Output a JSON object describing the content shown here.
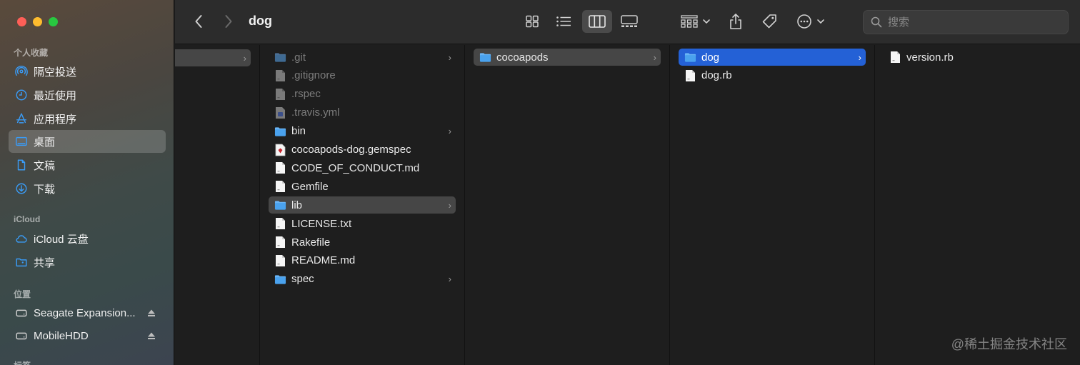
{
  "window": {
    "title": "dog"
  },
  "sidebar": {
    "sections": [
      {
        "label": "个人收藏"
      },
      {
        "label": "iCloud"
      },
      {
        "label": "位置"
      },
      {
        "label": "标签"
      }
    ],
    "favorites": [
      {
        "label": "隔空投送",
        "icon": "airdrop-icon"
      },
      {
        "label": "最近使用",
        "icon": "clock-icon"
      },
      {
        "label": "应用程序",
        "icon": "applications-icon"
      },
      {
        "label": "桌面",
        "icon": "desktop-icon",
        "selected": true
      },
      {
        "label": "文稿",
        "icon": "document-icon"
      },
      {
        "label": "下载",
        "icon": "download-icon"
      }
    ],
    "icloud": [
      {
        "label": "iCloud 云盘",
        "icon": "cloud-icon"
      },
      {
        "label": "共享",
        "icon": "shared-folder-icon"
      }
    ],
    "locations": [
      {
        "label": "Seagate Expansion...",
        "icon": "drive-icon"
      },
      {
        "label": "MobileHDD",
        "icon": "drive-icon"
      }
    ]
  },
  "toolbar": {
    "search_placeholder": "搜索"
  },
  "columns": {
    "col2": [
      {
        "name": ".git",
        "kind": "folder",
        "dim": true,
        "chevron": true
      },
      {
        "name": ".gitignore",
        "kind": "file",
        "dim": true
      },
      {
        "name": ".rspec",
        "kind": "file",
        "dim": true
      },
      {
        "name": ".travis.yml",
        "kind": "yml",
        "dim": true
      },
      {
        "name": "bin",
        "kind": "folder",
        "chevron": true
      },
      {
        "name": "cocoapods-dog.gemspec",
        "kind": "ruby"
      },
      {
        "name": "CODE_OF_CONDUCT.md",
        "kind": "file"
      },
      {
        "name": "Gemfile",
        "kind": "file"
      },
      {
        "name": "lib",
        "kind": "folder",
        "chevron": true,
        "selected": "gray"
      },
      {
        "name": "LICENSE.txt",
        "kind": "file"
      },
      {
        "name": "Rakefile",
        "kind": "file"
      },
      {
        "name": "README.md",
        "kind": "file"
      },
      {
        "name": "spec",
        "kind": "folder",
        "chevron": true
      }
    ],
    "col3": [
      {
        "name": "cocoapods",
        "kind": "folder",
        "chevron": true,
        "selected": "gray"
      }
    ],
    "col4": [
      {
        "name": "dog",
        "kind": "folder",
        "chevron": true,
        "selected": "blue"
      },
      {
        "name": "dog.rb",
        "kind": "file"
      }
    ],
    "col5": [
      {
        "name": "version.rb",
        "kind": "file"
      }
    ]
  },
  "watermark": "@稀土掘金技术社区"
}
